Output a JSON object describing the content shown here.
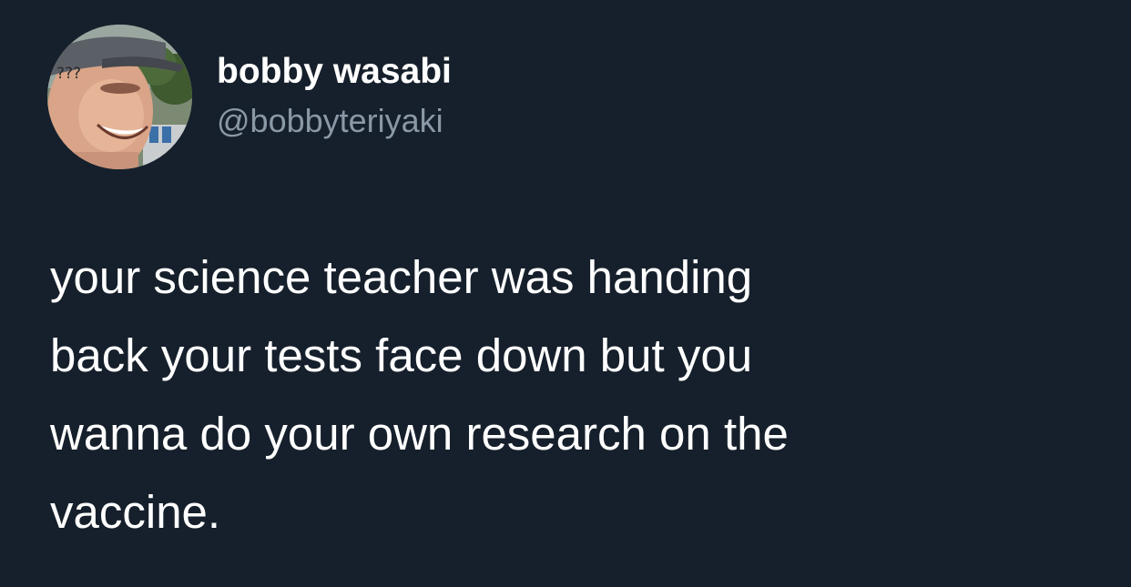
{
  "tweet": {
    "author": {
      "display_name": "bobby wasabi",
      "handle": "@bobbyteriyaki",
      "avatar_icon": "profile-photo",
      "avatar_overlay_text": "???"
    },
    "text": "your science teacher was handing\nback your tests face down but you\nwanna do your own research on the\nvaccine."
  },
  "colors": {
    "background": "#16202c",
    "primary_text": "#ffffff",
    "secondary_text": "#8b98a5"
  }
}
